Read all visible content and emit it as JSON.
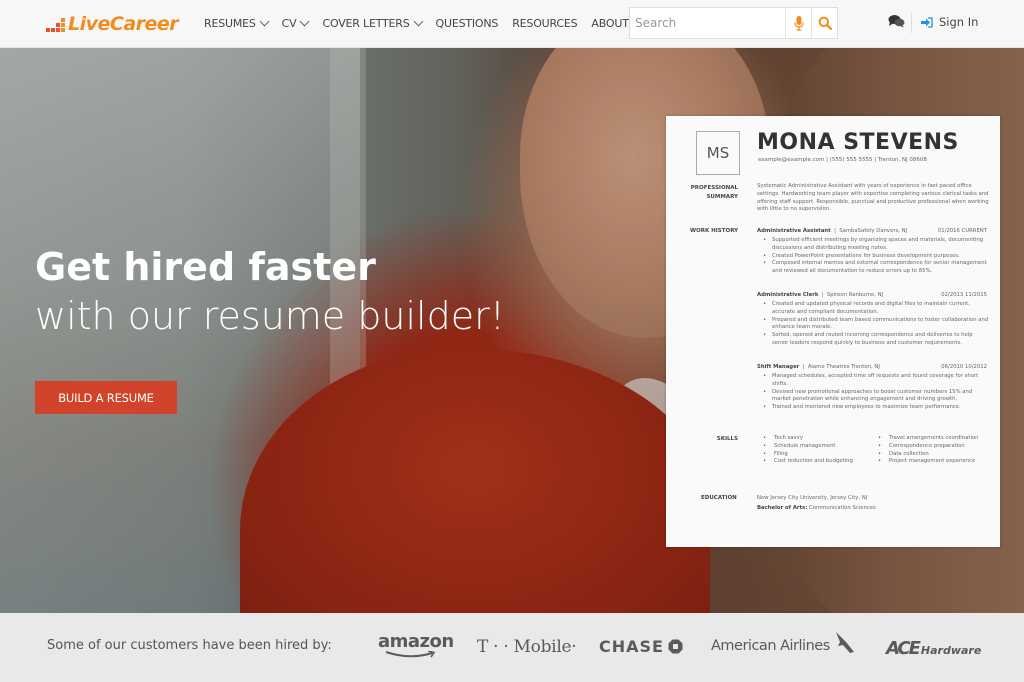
{
  "header": {
    "logo_text": "LiveCareer",
    "nav": [
      {
        "label": "RESUMES",
        "has_dropdown": true
      },
      {
        "label": "CV",
        "has_dropdown": true
      },
      {
        "label": "COVER LETTERS",
        "has_dropdown": true
      },
      {
        "label": "QUESTIONS",
        "has_dropdown": false
      },
      {
        "label": "RESOURCES",
        "has_dropdown": false
      },
      {
        "label": "ABOUT",
        "has_dropdown": true
      }
    ],
    "search": {
      "placeholder": "Search",
      "value": "",
      "mic_icon": "microphone-icon",
      "search_icon": "magnifier-icon"
    },
    "chat_icon": "chat-bubbles-icon",
    "signin_icon": "sign-in-arrow-icon",
    "signin_label": "Sign In"
  },
  "colors": {
    "brand_orange": "#f28c1f",
    "brand_red": "#e8502e",
    "cta_red": "#d2432c",
    "signin_blue": "#2d8fd5"
  },
  "hero": {
    "title_line1": "Get hired faster",
    "title_line2": "with our resume builder!",
    "cta_label": "BUILD A RESUME"
  },
  "resume": {
    "monogram": "MS",
    "name": "MONA STEVENS",
    "contact": "example@example.com   |   (555) 555 5555   |   Trenton, NJ 08608",
    "summary_label_1": "PROFESSIONAL",
    "summary_label_2": "SUMMARY",
    "summary": "Systematic Administrative Assistant with years of experience in fast paced office settings. Hardworking team player with expertise completing various clerical tasks and offering staff support. Responsible, punctual and productive professional when working with little to no supervision.",
    "work_label": "WORK HISTORY",
    "jobs": [
      {
        "title": "Administrative Assistant",
        "company": "SambaSafety   Danvers, NJ",
        "dates": "01/2016  CURRENT",
        "bullets": [
          "Supported efficient meetings by organizing spaces and materials, documenting discussions and distributing meeting notes.",
          "Created PowerPoint presentations for business development purposes.",
          "Composed internal memos and external correspondence for senior management and reviewed all documentation to reduce errors up to 85%."
        ]
      },
      {
        "title": "Administrative Clerk",
        "company": "Spireon   Ranburne, NJ",
        "dates": "02/2013  11/2015",
        "bullets": [
          "Created and updated physical records and digital files to maintain current, accurate and compliant documentation.",
          "Prepared and distributed team based communications to foster collaboration and enhance team morale.",
          "Sorted, opened and routed incoming correspondence and deliveries to help senior leaders respond quickly to business and customer requirements."
        ]
      },
      {
        "title": "Shift Manager",
        "company": "Alamo Theatres   Trenton, NJ",
        "dates": "06/2010  10/2012",
        "bullets": [
          "Managed schedules, accepted time off requests and found coverage for short shifts.",
          "Devised new promotional approaches to boost customer numbers 15% and market penetration while enhancing engagement and driving growth.",
          "Trained and mentored new employees to maximize team performance."
        ]
      }
    ],
    "skills_label": "SKILLS",
    "skills_col1": [
      "Tech savvy",
      "Schedule management",
      "Filing",
      "Cost reduction and budgeting"
    ],
    "skills_col2": [
      "Travel arrangements coordination",
      "Correspondence preparation",
      "Data collection",
      "Project management experience"
    ],
    "education_label": "EDUCATION",
    "education_school": "New Jersey City University, Jersey City, NJ",
    "education_degree_label": "Bachelor of Arts:",
    "education_degree": " Communication Sciences"
  },
  "customers": {
    "text": "Some of our customers have been hired by:",
    "brands": [
      "amazon",
      "T · · Mobile·",
      "CHASE",
      "American Airlines",
      "ACE",
      "Hardware"
    ]
  }
}
